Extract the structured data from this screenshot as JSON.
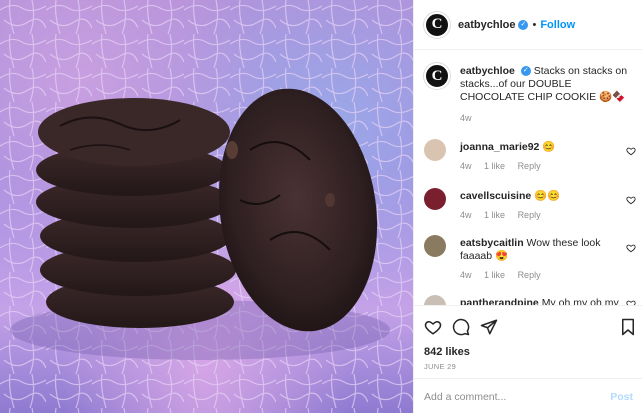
{
  "post": {
    "username": "eatbychloe",
    "follow_label": "Follow",
    "caption_text": "Stacks on stacks on stacks...of our DOUBLE CHOCOLATE CHIP COOKIE 🍪🍫",
    "caption_age": "4w",
    "avatar_letter": "C"
  },
  "comments": [
    {
      "user": "joanna_marie92",
      "text": "😊",
      "age": "4w",
      "likes": "1 like",
      "reply": "Reply"
    },
    {
      "user": "cavellscuisine",
      "text": "😊😊",
      "age": "4w",
      "likes": "1 like",
      "reply": "Reply"
    },
    {
      "user": "eatsbycaitlin",
      "text": "Wow these look faaaab 😍",
      "age": "4w",
      "likes": "1 like",
      "reply": "Reply"
    },
    {
      "user": "pantherandpine",
      "text": "My oh my oh my"
    }
  ],
  "footer": {
    "likes": "842 likes",
    "date": "JUNE 29",
    "comment_placeholder": "Add a comment...",
    "post_label": "Post"
  },
  "colors": {
    "link_blue": "#0095f6",
    "muted": "#8e8e8e",
    "post_disabled": "#b3dbff"
  }
}
